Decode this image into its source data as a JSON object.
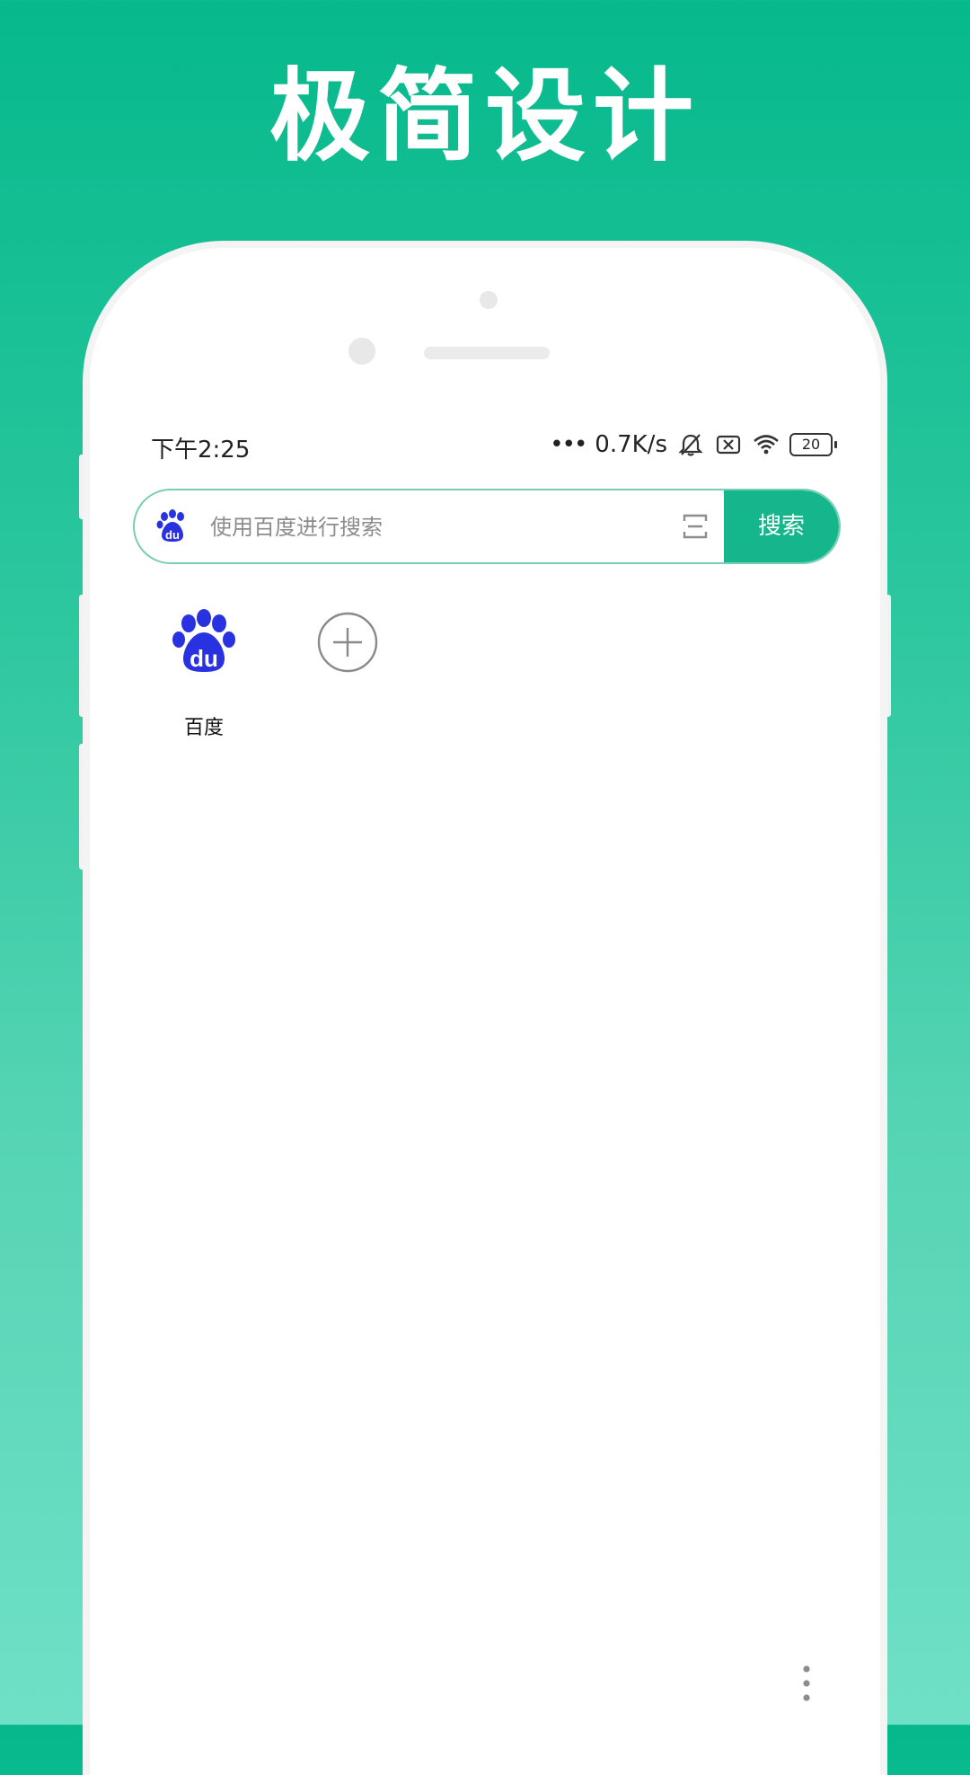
{
  "headline": "极简设计",
  "status_bar": {
    "time": "下午2:25",
    "network_speed": "0.7K/s",
    "battery": "20",
    "icons": [
      "signal-dots-icon",
      "bell-muted-icon",
      "sim-off-icon",
      "wifi-icon",
      "battery-icon"
    ]
  },
  "search": {
    "engine_icon": "baidu-paw-icon",
    "placeholder": "使用百度进行搜索",
    "scan_icon": "scan-icon",
    "button_label": "搜索"
  },
  "shortcuts": [
    {
      "label": "百度",
      "icon": "baidu-logo-icon"
    },
    {
      "label": "",
      "icon": "add-circle-icon"
    }
  ],
  "colors": {
    "accent": "#16b68c",
    "background_top": "#05b98c",
    "background_bottom": "#6fe0c6",
    "baidu_blue": "#2932e1"
  },
  "more_icon": "more-vertical-icon"
}
